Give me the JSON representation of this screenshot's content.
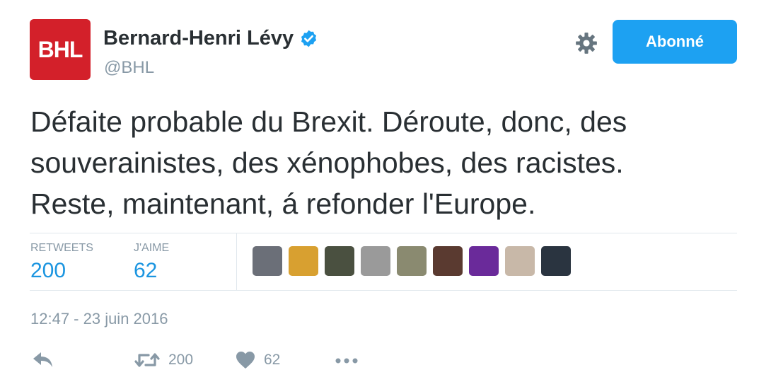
{
  "tweet": {
    "avatar_text": "BHL",
    "author_name": "Bernard-Henri Lévy",
    "handle": "@BHL",
    "follow_label": "Abonné",
    "text": "Défaite probable du Brexit. Déroute, donc, des\nsouverainistes, des xénophobes, des racistes.\nReste, maintenant, á refonder l'Europe.",
    "timestamp": "12:47 - 23 juin 2016"
  },
  "stats": {
    "retweets_label": "RETWEETS",
    "retweets_value": "200",
    "likes_label": "J'AIME",
    "likes_value": "62"
  },
  "actions": {
    "retweet_count": "200",
    "like_count": "62"
  },
  "likers": [
    {
      "name": "liker-avatar-1",
      "color": "#6b6f78"
    },
    {
      "name": "liker-avatar-2",
      "color": "#d8a030"
    },
    {
      "name": "liker-avatar-3",
      "color": "#4a5040"
    },
    {
      "name": "liker-avatar-4",
      "color": "#9a9a9a"
    },
    {
      "name": "liker-avatar-5",
      "color": "#8a8a70"
    },
    {
      "name": "liker-avatar-6",
      "color": "#5a3a30"
    },
    {
      "name": "liker-avatar-7",
      "color": "#6a2a9a"
    },
    {
      "name": "liker-avatar-8",
      "color": "#c8b8a8"
    },
    {
      "name": "liker-avatar-9",
      "color": "#2a3440"
    }
  ],
  "colors": {
    "brand_red": "#d3202a",
    "accent_blue": "#1da1f2",
    "stat_blue": "#1b95e0",
    "muted_gray": "#8899a6"
  }
}
